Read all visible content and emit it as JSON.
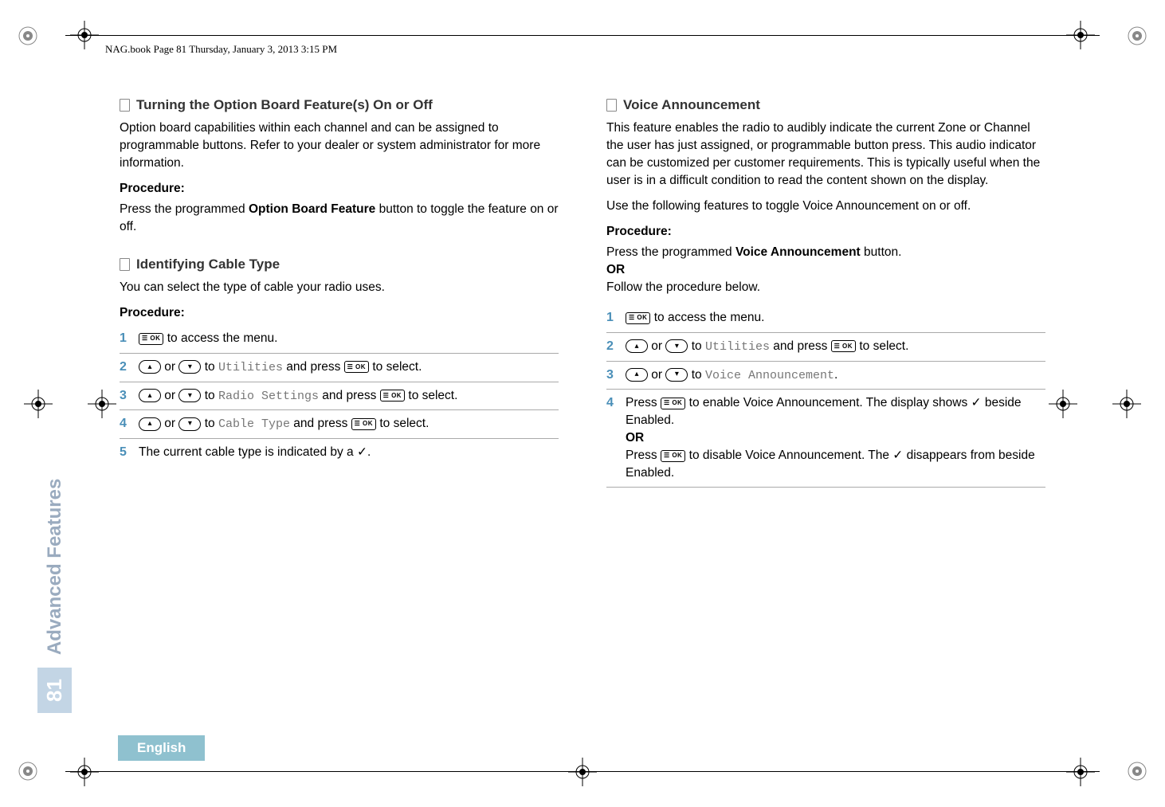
{
  "header": "NAG.book  Page 81  Thursday, January 3, 2013  3:15 PM",
  "side": {
    "title": "Advanced Features",
    "page": "81"
  },
  "footer": {
    "language": "English"
  },
  "icons": {
    "menu_ok": "☰ OK",
    "up": "▴",
    "down": "▾",
    "check": "✓"
  },
  "left": {
    "section1": {
      "title": "Turning the Option Board Feature(s) On or Off",
      "para": "Option board capabilities within each channel and can be assigned to programmable buttons. Refer to your dealer or system administrator for more information.",
      "proc_label": "Procedure:",
      "proc_text_a": "Press the programmed ",
      "proc_text_bold": "Option Board Feature",
      "proc_text_b": " button to toggle the feature on or off."
    },
    "section2": {
      "title": "Identifying Cable Type",
      "para": "You can select the type of cable your radio uses.",
      "proc_label": "Procedure:",
      "steps": {
        "s1": " to access the menu.",
        "s2a": " or ",
        "s2b": " to ",
        "s2c": "Utilities",
        "s2d": " and press ",
        "s2e": " to select.",
        "s3a": " or ",
        "s3b": " to ",
        "s3c": "Radio Settings",
        "s3d": " and press ",
        "s3e": " to select.",
        "s4a": " or ",
        "s4b": " to ",
        "s4c": "Cable Type",
        "s4d": " and press ",
        "s4e": " to select.",
        "s5a": "The current cable type is indicated by a ",
        "s5b": "."
      }
    }
  },
  "right": {
    "section1": {
      "title": "Voice Announcement",
      "para1": "This feature enables the radio to audibly indicate the current Zone or Channel the user has just assigned, or programmable button press. This audio indicator can be customized per customer requirements. This is typically useful when the user is in a difficult condition to read the content shown on the display.",
      "para2": "Use the following features to toggle Voice Announcement on or off.",
      "proc_label": "Procedure:",
      "intro_a": "Press the programmed ",
      "intro_bold": "Voice Announcement",
      "intro_b": " button.",
      "or": "OR",
      "intro_c": "Follow the procedure below.",
      "steps": {
        "s1": " to access the menu.",
        "s2a": " or ",
        "s2b": " to ",
        "s2c": "Utilities",
        "s2d": " and press ",
        "s2e": " to select.",
        "s3a": " or ",
        "s3b": " to ",
        "s3c": "Voice Announcement",
        "s3d": ".",
        "s4a": "Press ",
        "s4b": " to enable Voice Announcement. The display shows ",
        "s4c": " beside Enabled.",
        "s4or": "OR",
        "s4d": "Press ",
        "s4e": " to disable Voice Announcement. The ",
        "s4f": " disappears from beside Enabled."
      }
    }
  }
}
